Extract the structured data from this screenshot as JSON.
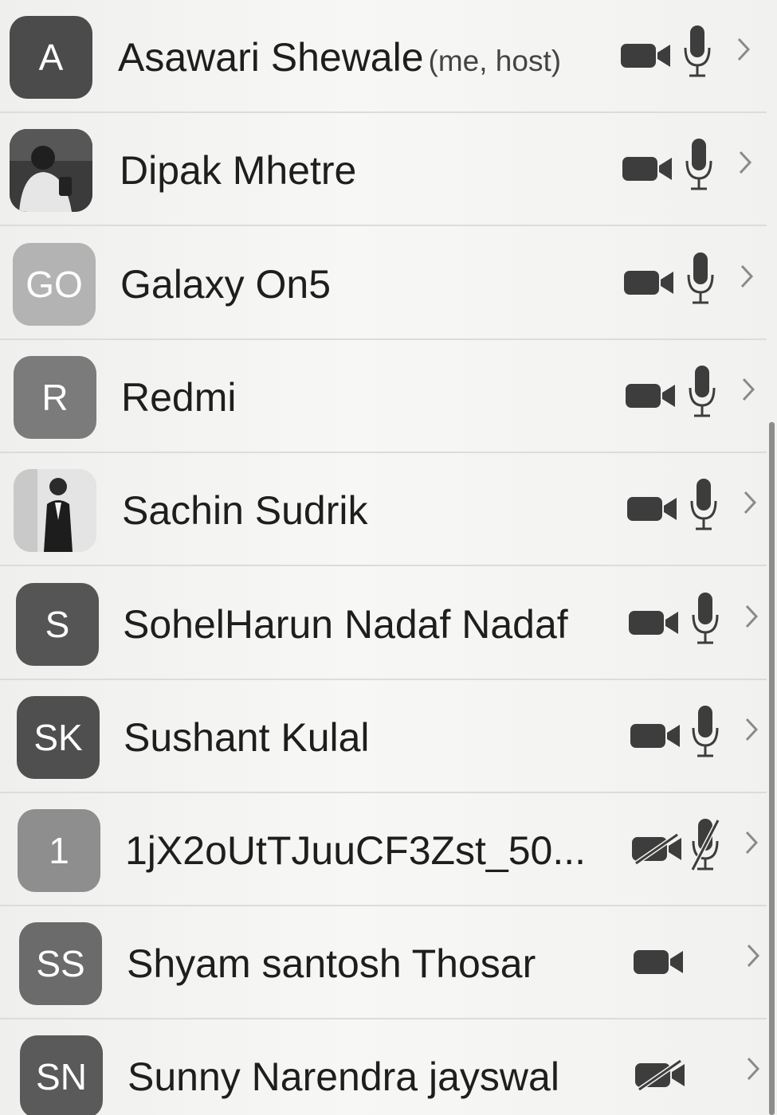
{
  "participants": [
    {
      "initials": "A",
      "avatar_color": "#4b4b4b",
      "avatar_type": "initials",
      "name": "Asawari Shewale",
      "suffix": "(me, host)",
      "video": "on",
      "audio": "on"
    },
    {
      "initials": "",
      "avatar_color": "#3a3a3a",
      "avatar_type": "photo",
      "name": "Dipak Mhetre",
      "suffix": "",
      "video": "on",
      "audio": "on"
    },
    {
      "initials": "GO",
      "avatar_color": "#b3b3b3",
      "avatar_type": "initials",
      "name": "Galaxy On5",
      "suffix": "",
      "video": "on",
      "audio": "on"
    },
    {
      "initials": "R",
      "avatar_color": "#7b7b7b",
      "avatar_type": "initials",
      "name": "Redmi",
      "suffix": "",
      "video": "on",
      "audio": "on"
    },
    {
      "initials": "",
      "avatar_color": "#d6d6d6",
      "avatar_type": "photo",
      "name": "Sachin Sudrik",
      "suffix": "",
      "video": "on",
      "audio": "on"
    },
    {
      "initials": "S",
      "avatar_color": "#555555",
      "avatar_type": "initials",
      "name": "SohelHarun Nadaf Nadaf",
      "suffix": "",
      "video": "on",
      "audio": "on"
    },
    {
      "initials": "SK",
      "avatar_color": "#4f4f4f",
      "avatar_type": "initials",
      "name": "Sushant Kulal",
      "suffix": "",
      "video": "on",
      "audio": "on"
    },
    {
      "initials": "1",
      "avatar_color": "#8e8e8e",
      "avatar_type": "initials",
      "name": "1jX2oUtTJuuCF3Zst_50...",
      "suffix": "",
      "video": "off",
      "audio": "off"
    },
    {
      "initials": "SS",
      "avatar_color": "#6b6b6b",
      "avatar_type": "initials",
      "name": "Shyam santosh Thosar",
      "suffix": "",
      "video": "on",
      "audio": "none"
    },
    {
      "initials": "SN",
      "avatar_color": "#5a5a5a",
      "avatar_type": "initials",
      "name": "Sunny Narendra jayswal",
      "suffix": "",
      "video": "off",
      "audio": "none"
    }
  ],
  "icons": {
    "video_on": "video-camera-icon",
    "video_off": "video-camera-off-icon",
    "audio_on": "microphone-icon",
    "audio_off": "microphone-muted-icon",
    "chevron": "chevron-right-icon"
  }
}
